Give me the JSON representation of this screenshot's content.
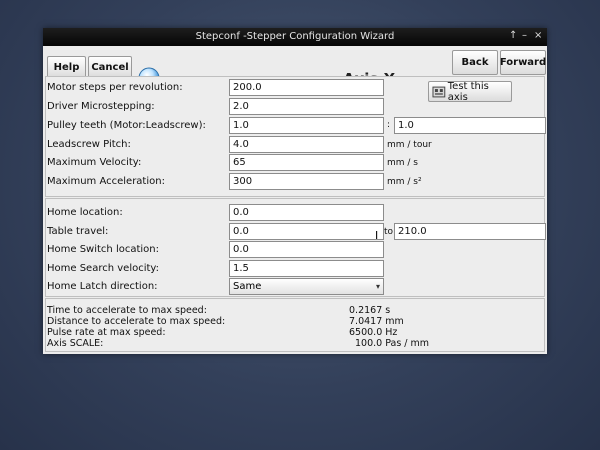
{
  "window": {
    "title": "Stepconf -Stepper Configuration Wizard",
    "controls": [
      "↑",
      "–",
      "×"
    ]
  },
  "toolbar": {
    "help_label": "Help",
    "cancel_label": "Cancel",
    "heading": "Axis X",
    "back_label": "Back",
    "forward_label": "Forward"
  },
  "motor": {
    "steps_label": "Motor steps per revolution:",
    "steps_value": "200.0",
    "microstep_label": "Driver Microstepping:",
    "microstep_value": "2.0",
    "pulley_label": "Pulley teeth (Motor:Leadscrew):",
    "pulley_motor": "1.0",
    "pulley_sep": ":",
    "pulley_screw": "1.0",
    "pitch_label": "Leadscrew Pitch:",
    "pitch_value": "4.0",
    "pitch_unit": "mm / tour",
    "vel_label": "Maximum Velocity:",
    "vel_value": "65",
    "vel_unit": "mm / s",
    "acc_label": "Maximum Acceleration:",
    "acc_value": "300",
    "acc_unit": "mm / s²",
    "test_label": "Test this axis"
  },
  "home": {
    "location_label": "Home location:",
    "location_value": "0.0",
    "travel_label": "Table travel:",
    "travel_from": "0.0",
    "travel_to_label": "to",
    "travel_to": "210.0",
    "switch_label": "Home Switch location:",
    "switch_value": "0.0",
    "search_label": "Home Search velocity:",
    "search_value": "1.5",
    "latch_label": "Home Latch direction:",
    "latch_value": "Same"
  },
  "info": {
    "time_label": "Time to accelerate to max speed:",
    "time_value": "0.2167 s",
    "dist_label": "Distance to accelerate to max speed:",
    "dist_value": "7.0417 mm",
    "pulse_label": "Pulse rate at max speed:",
    "pulse_value": "6500.0 Hz",
    "scale_label": "Axis SCALE:",
    "scale_value": "100.0 Pas / mm"
  }
}
